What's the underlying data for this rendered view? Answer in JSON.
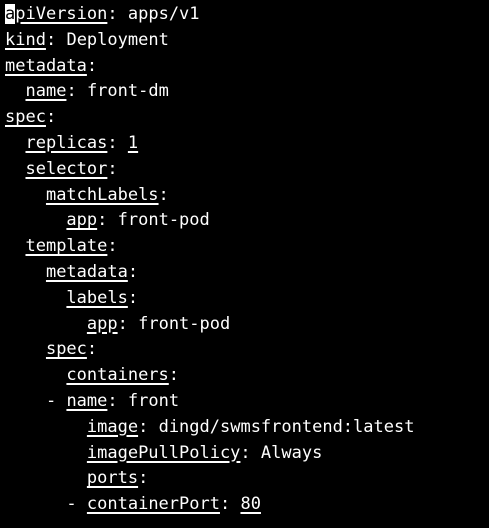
{
  "colors": {
    "background": "#000000",
    "foreground": "#ffffff"
  },
  "editor": {
    "cursor_char": "a",
    "lines": [
      {
        "indent": 0,
        "dash": "",
        "key": "apiVersion",
        "value": "apps/v1",
        "value_underline": false
      },
      {
        "indent": 0,
        "dash": "",
        "key": "kind",
        "value": "Deployment",
        "value_underline": false
      },
      {
        "indent": 0,
        "dash": "",
        "key": "metadata",
        "value": "",
        "value_underline": false
      },
      {
        "indent": 1,
        "dash": "",
        "key": "name",
        "value": "front-dm",
        "value_underline": false
      },
      {
        "indent": 0,
        "dash": "",
        "key": "spec",
        "value": "",
        "value_underline": false
      },
      {
        "indent": 1,
        "dash": "",
        "key": "replicas",
        "value": "1",
        "value_underline": true
      },
      {
        "indent": 1,
        "dash": "",
        "key": "selector",
        "value": "",
        "value_underline": false
      },
      {
        "indent": 2,
        "dash": "",
        "key": "matchLabels",
        "value": "",
        "value_underline": false
      },
      {
        "indent": 3,
        "dash": "",
        "key": "app",
        "value": "front-pod",
        "value_underline": false
      },
      {
        "indent": 1,
        "dash": "",
        "key": "template",
        "value": "",
        "value_underline": false
      },
      {
        "indent": 2,
        "dash": "",
        "key": "metadata",
        "value": "",
        "value_underline": false
      },
      {
        "indent": 3,
        "dash": "",
        "key": "labels",
        "value": "",
        "value_underline": false
      },
      {
        "indent": 4,
        "dash": "",
        "key": "app",
        "value": "front-pod",
        "value_underline": false
      },
      {
        "indent": 2,
        "dash": "",
        "key": "spec",
        "value": "",
        "value_underline": false
      },
      {
        "indent": 3,
        "dash": "",
        "key": "containers",
        "value": "",
        "value_underline": false
      },
      {
        "indent": 3,
        "dash": "- ",
        "key": "name",
        "value": "front",
        "value_underline": false
      },
      {
        "indent": 4,
        "dash": "",
        "key": "image",
        "value": "dingd/swmsfrontend:latest",
        "value_underline": false
      },
      {
        "indent": 4,
        "dash": "",
        "key": "imagePullPolicy",
        "value": "Always",
        "value_underline": false
      },
      {
        "indent": 4,
        "dash": "",
        "key": "ports",
        "value": "",
        "value_underline": false
      },
      {
        "indent": 4,
        "dash": "- ",
        "key": "containerPort",
        "value": "80",
        "value_underline": true
      }
    ]
  }
}
